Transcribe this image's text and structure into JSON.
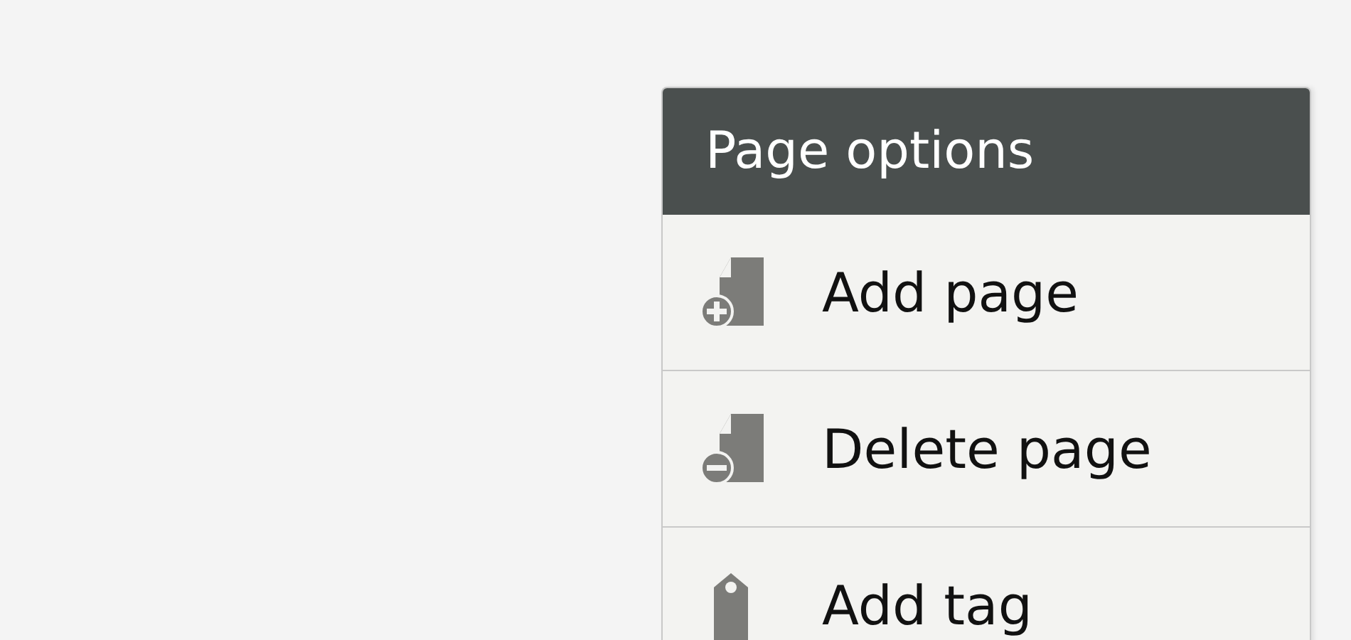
{
  "menu": {
    "title": "Page options",
    "items": [
      {
        "kind": "add",
        "label": "Add page"
      },
      {
        "kind": "delete",
        "label": "Delete page"
      },
      {
        "kind": "tag",
        "label": "Add tag"
      }
    ]
  }
}
